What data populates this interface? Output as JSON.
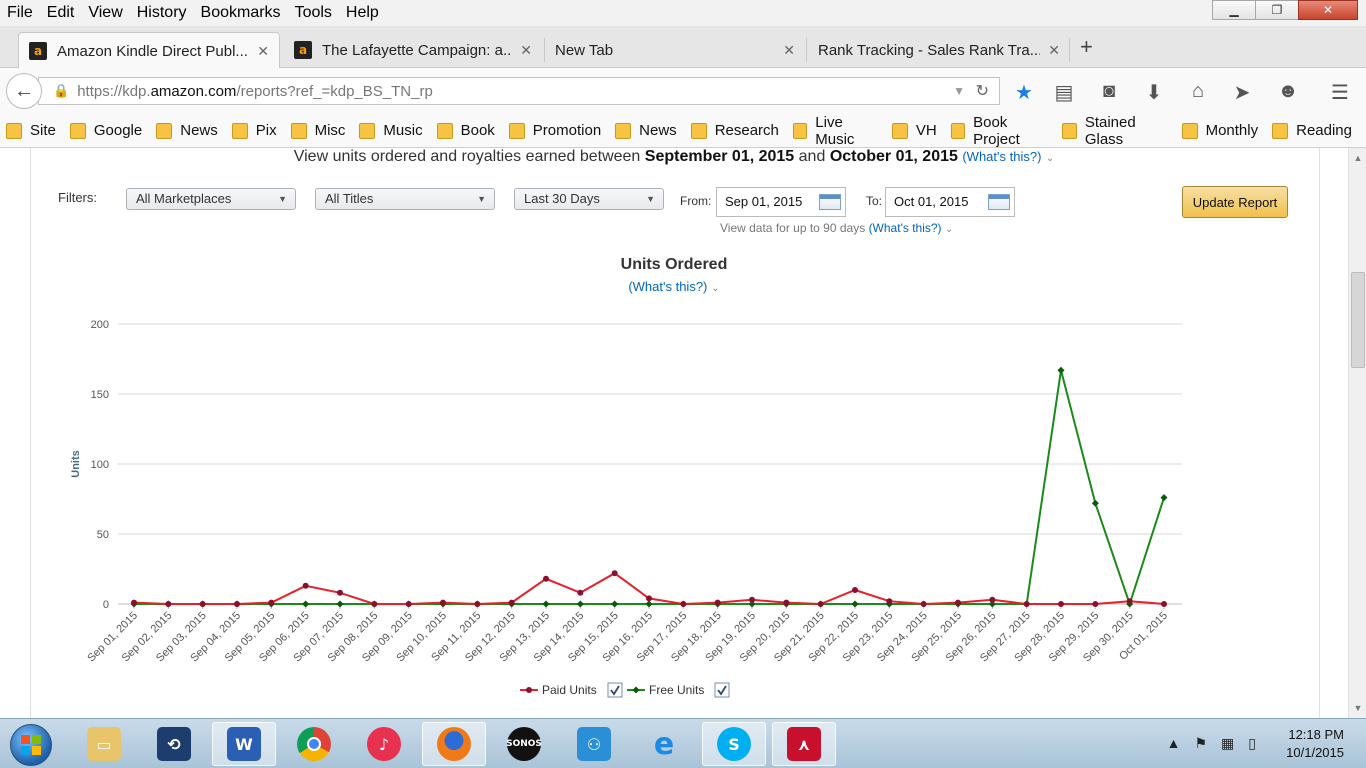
{
  "menubar": {
    "items": [
      "File",
      "Edit",
      "View",
      "History",
      "Bookmarks",
      "Tools",
      "Help"
    ]
  },
  "tabs": [
    {
      "title": "Amazon Kindle Direct Publ...",
      "active": true
    },
    {
      "title": "The Lafayette Campaign: a...",
      "active": false
    },
    {
      "title": "New Tab",
      "active": false
    },
    {
      "title": "Rank Tracking - Sales Rank Tra...",
      "active": false
    }
  ],
  "url": {
    "prefix": "https://kdp.",
    "domain": "amazon.com",
    "path": "/reports?ref_=kdp_BS_TN_rp"
  },
  "bookmarks": [
    "Site",
    "Google",
    "News",
    "Pix",
    "Misc",
    "Music",
    "Book",
    "Promotion",
    "News",
    "Research",
    "Live Music",
    "VH",
    "Book Project",
    "Stained Glass",
    "Monthly",
    "Reading"
  ],
  "page": {
    "heading_prefix": "View units ordered and royalties earned between",
    "heading_start": "September 01, 2015",
    "heading_and": "and",
    "heading_end": "October 01, 2015",
    "whats_this": "(What's this?)",
    "filters_label": "Filters:",
    "marketplace": "All Marketplaces",
    "titles": "All Titles",
    "range": "Last 30 Days",
    "from_label": "From:",
    "from_value": "Sep 01, 2015",
    "to_label": "To:",
    "to_value": "Oct 01, 2015",
    "hint": "View data for up to 90 days",
    "update_button": "Update Report"
  },
  "chart_data": {
    "type": "line",
    "title": "Units Ordered",
    "subtitle": "(What's this?)",
    "ylabel": "Units",
    "xlabel": "",
    "ylim": [
      0,
      200
    ],
    "yticks": [
      0,
      50,
      100,
      150,
      200
    ],
    "grid": true,
    "legend_position": "bottom",
    "categories": [
      "Sep 01, 2015",
      "Sep 02, 2015",
      "Sep 03, 2015",
      "Sep 04, 2015",
      "Sep 05, 2015",
      "Sep 06, 2015",
      "Sep 07, 2015",
      "Sep 08, 2015",
      "Sep 09, 2015",
      "Sep 10, 2015",
      "Sep 11, 2015",
      "Sep 12, 2015",
      "Sep 13, 2015",
      "Sep 14, 2015",
      "Sep 15, 2015",
      "Sep 16, 2015",
      "Sep 17, 2015",
      "Sep 18, 2015",
      "Sep 19, 2015",
      "Sep 20, 2015",
      "Sep 21, 2015",
      "Sep 22, 2015",
      "Sep 23, 2015",
      "Sep 24, 2015",
      "Sep 25, 2015",
      "Sep 26, 2015",
      "Sep 27, 2015",
      "Sep 28, 2015",
      "Sep 29, 2015",
      "Sep 30, 2015",
      "Oct 01, 2015"
    ],
    "series": [
      {
        "name": "Paid Units",
        "color": "#e8202a",
        "values": [
          1,
          0,
          0,
          0,
          1,
          13,
          8,
          0,
          0,
          1,
          0,
          1,
          18,
          8,
          22,
          4,
          0,
          1,
          3,
          1,
          0,
          10,
          2,
          0,
          1,
          3,
          0,
          0,
          0,
          2,
          0
        ]
      },
      {
        "name": "Free Units",
        "color": "#1a8a1a",
        "values": [
          0,
          0,
          0,
          0,
          0,
          0,
          0,
          0,
          0,
          0,
          0,
          0,
          0,
          0,
          0,
          0,
          0,
          0,
          0,
          0,
          0,
          0,
          0,
          0,
          0,
          0,
          0,
          167,
          72,
          0,
          76
        ]
      }
    ]
  },
  "taskbar": {
    "apps": [
      "Windows Explorer",
      "Remote Desktop",
      "Microsoft Word",
      "Google Chrome",
      "iTunes",
      "Firefox",
      "SONOS",
      "Lync",
      "Internet Explorer",
      "Skype",
      "Adobe Acrobat"
    ],
    "sonos_label": "SONOS",
    "time": "12:18 PM",
    "date": "10/1/2015"
  }
}
